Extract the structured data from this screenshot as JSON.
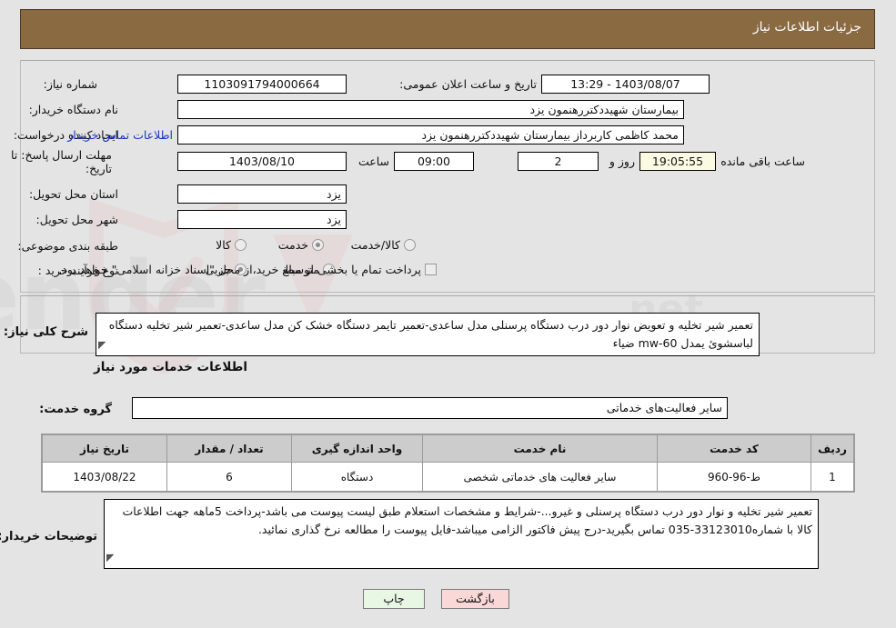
{
  "header": {
    "title": "جزئیات اطلاعات نیاز"
  },
  "form": {
    "need_number_label": "شماره نیاز:",
    "need_number_value": "1103091794000664",
    "public_announce_label": "تاریخ و ساعت اعلان عمومی:",
    "public_announce_value": "1403/08/07 - 13:29",
    "buyer_org_label": "نام دستگاه خریدار:",
    "buyer_org_value": "بیمارستان شهیددکتررهنمون یزد",
    "creator_label": "ایجاد کننده درخواست:",
    "creator_value": "محمد کاظمی کاربرداز بیمارستان شهیددکتررهنمون یزد",
    "buyer_contact_link": "اطلاعات تماس خریدار",
    "deadline_label": "مهلت ارسال پاسخ: تا تاریخ:",
    "deadline_date": "1403/08/10",
    "deadline_hour_label": "ساعت",
    "deadline_hour_value": "09:00",
    "remaining_days_value": "2",
    "remaining_days_label": "روز و",
    "remaining_timer_value": "19:05:55",
    "remaining_timer_label": "ساعت باقی مانده",
    "province_label": "استان محل تحویل:",
    "province_value": "یزد",
    "city_label": "شهر محل تحویل:",
    "city_value": "یزد",
    "classification_label": "طبقه بندی موضوعی:",
    "classification_options": [
      {
        "label": "کالا",
        "selected": false
      },
      {
        "label": "خدمت",
        "selected": true
      },
      {
        "label": "کالا/خدمت",
        "selected": false
      }
    ],
    "purchase_type_label": "نوع فرآیند خرید :",
    "purchase_type_options": [
      {
        "label": "جزیی",
        "selected": true
      },
      {
        "label": "متوسط",
        "selected": false
      }
    ],
    "payment_checkbox_label": "پرداخت تمام یا بخشی از مبلغ خرید،از محل \"اسناد خزانه اسلامی\" خواهد بود.",
    "payment_checked": false,
    "general_desc_label": "شرح کلی نیاز:",
    "general_desc_value": "تعمیر شیر تخلیه و تعویض نوار دور درب دستگاه پرسنلی مدل ساعدی-تعمیر تایمر دستگاه خشک کن مدل ساعدی-تعمیر شیر تخلیه دستگاه لباسشوئ یمدل mw-60 ضیاء"
  },
  "services_section": {
    "heading": "اطلاعات خدمات مورد نیاز",
    "service_group_label": "گروه خدمت:",
    "service_group_value": "سایر فعالیت‌های خدماتی"
  },
  "table": {
    "columns": [
      "ردیف",
      "کد خدمت",
      "نام خدمت",
      "واحد اندازه گیری",
      "تعداد / مقدار",
      "تاریخ نیاز"
    ],
    "rows": [
      {
        "row": "1",
        "code": "ط-96-960",
        "name": "سایر فعالیت های خدماتی شخصی",
        "unit": "دستگاه",
        "quantity": "6",
        "need_date": "1403/08/22"
      }
    ]
  },
  "buyer_notes": {
    "label": "توضیحات خریدار:",
    "value": "تعمیر شیر تخلیه و نوار دور درب دستگاه پرسنلی و غیرو...-شرایط و مشخصات استعلام طبق لیست پیوست می باشد-پرداخت 5ماهه جهت اطلاعات کالا با شماره33123010-035 تماس بگیرید-درج پیش فاکتور الزامی میباشد-فایل پیوست را مطالعه نرخ گذاری نمائید."
  },
  "buttons": {
    "print": "چاپ",
    "back": "بازگشت"
  },
  "colors": {
    "header_bg": "#8a6a41",
    "header_text": "#ffffff",
    "page_bg": "#e4e4e4",
    "link": "#1a36c8",
    "timer_bg": "#fbfbe4",
    "table_header_bg": "#cccccc",
    "print_btn_bg": "#e8f6e4",
    "back_btn_bg": "#fbd8d8"
  }
}
